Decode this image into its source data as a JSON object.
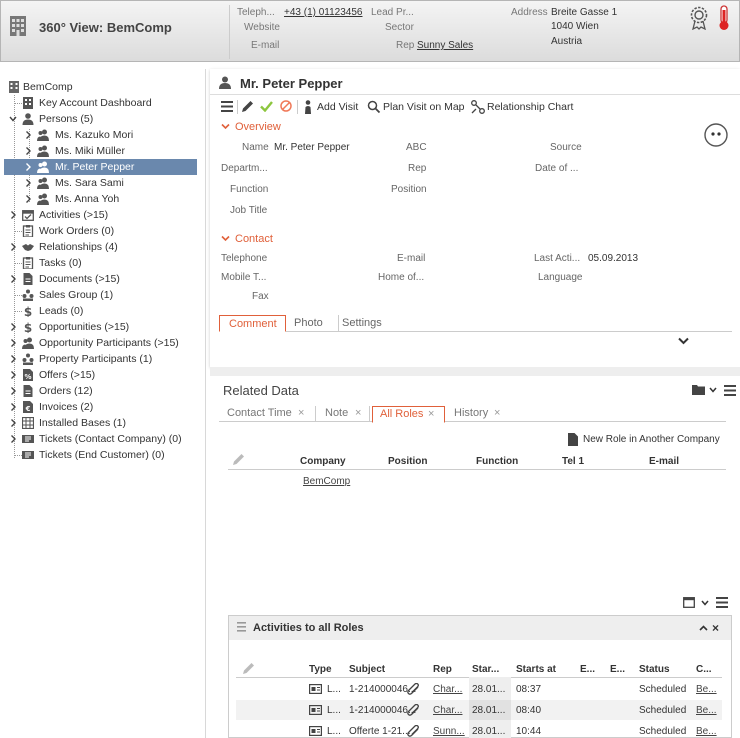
{
  "header": {
    "title": "360° View: BemComp",
    "telephone_label": "Teleph...",
    "telephone_value": "+43 (1) 01123456",
    "lead_label": "Lead Pr...",
    "website_label": "Website",
    "sector_label": "Sector",
    "email_label": "E-mail",
    "rep_label": "Rep",
    "rep_value": "Sunny Sales",
    "address_label": "Address",
    "address_line1": "Breite Gasse 1",
    "address_line2": "1040 Wien",
    "address_line3": "Austria"
  },
  "sidebar": {
    "root": "BemComp",
    "items": [
      {
        "label": "Key Account Dashboard"
      },
      {
        "label": "Persons (5)"
      },
      {
        "label": "Ms. Kazuko Mori"
      },
      {
        "label": "Ms. Miki Müller"
      },
      {
        "label": "Mr. Peter Pepper"
      },
      {
        "label": "Ms. Sara Sami"
      },
      {
        "label": "Ms. Anna Yoh"
      },
      {
        "label": "Activities (>15)"
      },
      {
        "label": "Work Orders (0)"
      },
      {
        "label": "Relationships (4)"
      },
      {
        "label": "Tasks (0)"
      },
      {
        "label": "Documents (>15)"
      },
      {
        "label": "Sales Group (1)"
      },
      {
        "label": "Leads (0)"
      },
      {
        "label": "Opportunities (>15)"
      },
      {
        "label": "Opportunity Participants (>15)"
      },
      {
        "label": "Property Participants (1)"
      },
      {
        "label": "Offers (>15)"
      },
      {
        "label": "Orders (12)"
      },
      {
        "label": "Invoices (2)"
      },
      {
        "label": "Installed Bases (1)"
      },
      {
        "label": "Tickets (Contact Company) (0)"
      },
      {
        "label": "Tickets (End Customer) (0)"
      }
    ]
  },
  "person": {
    "title": "Mr. Peter Pepper",
    "toolbar": {
      "add_visit": "Add Visit",
      "plan_visit": "Plan Visit on Map",
      "relationship_chart": "Relationship Chart"
    },
    "overview": {
      "heading": "Overview",
      "name_label": "Name",
      "name_value": "Mr. Peter Pepper",
      "abc_label": "ABC",
      "source_label": "Source",
      "department_label": "Departm...",
      "rep_label": "Rep",
      "date_label": "Date of ...",
      "function_label": "Function",
      "position_label": "Position",
      "job_title_label": "Job Title"
    },
    "contact": {
      "heading": "Contact",
      "telephone_label": "Telephone",
      "email_label": "E-mail",
      "last_activity_label": "Last Acti...",
      "last_activity_value": "05.09.2013",
      "mobile_label": "Mobile T...",
      "home_label": "Home of...",
      "language_label": "Language",
      "fax_label": "Fax"
    },
    "tabs": [
      "Comment",
      "Photo",
      "Settings"
    ]
  },
  "related": {
    "title": "Related Data",
    "tabs": [
      "Contact Time",
      "Note",
      "All Roles",
      "History"
    ],
    "new_role": "New Role in Another Company",
    "columns": [
      "Company",
      "Position",
      "Function",
      "Tel 1",
      "E-mail"
    ],
    "rows": [
      {
        "company": "BemComp"
      }
    ]
  },
  "activities": {
    "title": "Activities to all Roles",
    "columns": [
      "Type",
      "Subject",
      "Rep",
      "Star...",
      "Starts at",
      "E...",
      "E...",
      "Status",
      "C..."
    ],
    "rows": [
      {
        "type": "L...",
        "subject": "1-214000046...",
        "rep": "Char...",
        "start": "28.01...",
        "starts_at": "08:37",
        "status": "Scheduled",
        "c": "Be..."
      },
      {
        "type": "L...",
        "subject": "1-214000046...",
        "rep": "Char...",
        "start": "28.01...",
        "starts_at": "08:40",
        "status": "Scheduled",
        "c": "Be..."
      },
      {
        "type": "L...",
        "subject": "Offerte 1-21...",
        "rep": "Sunn...",
        "start": "28.01...",
        "starts_at": "10:44",
        "status": "Scheduled",
        "c": "Be..."
      }
    ]
  },
  "colors": {
    "accent": "#e0603a",
    "selection": "#6a88ad",
    "check": "#8dc63f"
  }
}
